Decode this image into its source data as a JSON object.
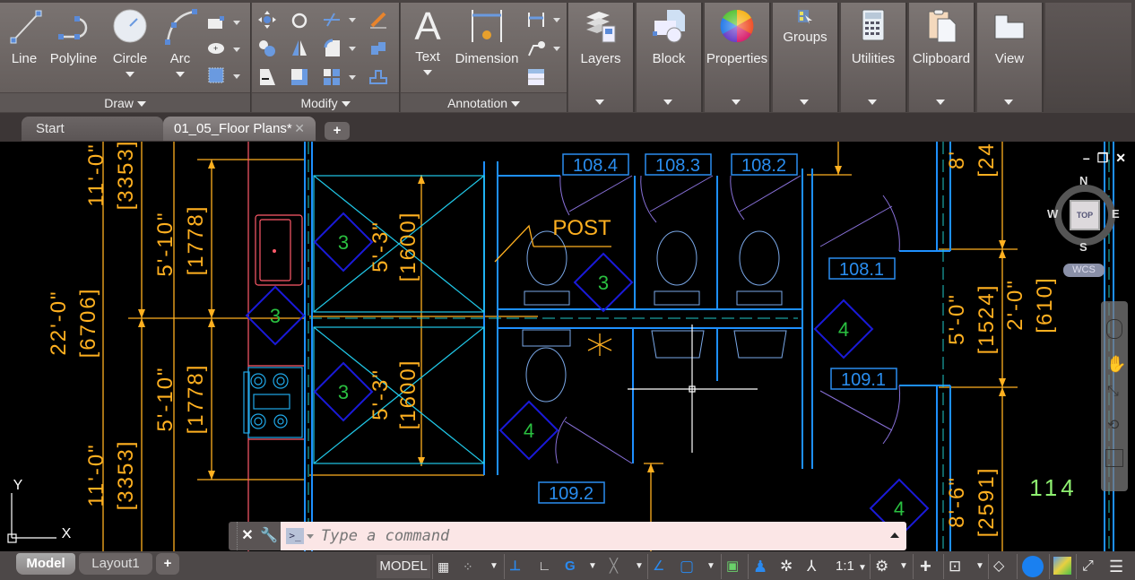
{
  "ribbon": {
    "draw": {
      "title": "Draw",
      "buttons": [
        {
          "label": "Line"
        },
        {
          "label": "Polyline"
        },
        {
          "label": "Circle"
        },
        {
          "label": "Arc"
        }
      ]
    },
    "modify": {
      "title": "Modify"
    },
    "annotation": {
      "title": "Annotation",
      "buttons": [
        {
          "label": "Text"
        },
        {
          "label": "Dimension"
        }
      ]
    },
    "panels": [
      {
        "label": "Layers",
        "icon": "layers-icon"
      },
      {
        "label": "Block",
        "icon": "block-icon"
      },
      {
        "label": "Properties",
        "icon": "properties-icon"
      },
      {
        "label": "Groups",
        "icon": "groups-icon"
      },
      {
        "label": "Utilities",
        "icon": "calculator-icon"
      },
      {
        "label": "Clipboard",
        "icon": "clipboard-icon"
      },
      {
        "label": "View",
        "icon": "view-icon"
      }
    ]
  },
  "doc_tabs": [
    {
      "label": "Start",
      "active": false
    },
    {
      "label": "01_05_Floor Plans*",
      "active": true
    }
  ],
  "drawing": {
    "room_tags": [
      "108.4",
      "108.3",
      "108.2",
      "108.1",
      "109.1",
      "109.2"
    ],
    "room_number": "114",
    "note": "POST",
    "type_markers": [
      "3",
      "3",
      "3",
      "3",
      "4",
      "4",
      "4"
    ],
    "dimensions_left": [
      "11'-0\"",
      "[3353]",
      "22'-0\"",
      "[6706]",
      "5'-10\"",
      "[1778]",
      "5'-10\"",
      "[1778]",
      "11'-0\"",
      "[3353]"
    ],
    "dimensions_mid": [
      "5'-3\"",
      "[1600]",
      "5'-3\"",
      "[1600]"
    ],
    "dimensions_right": [
      "8'",
      "[24",
      "5'-0\"",
      "[1524]",
      "2'-0\"",
      "[610]",
      "8'-6\"",
      "[2591]"
    ],
    "ucs": {
      "x": "X",
      "y": "Y"
    }
  },
  "viewcube": {
    "n": "N",
    "s": "S",
    "e": "E",
    "w": "W",
    "face": "TOP",
    "wcs": "WCS"
  },
  "window_controls": {
    "minimize": "–",
    "restore": "❐",
    "close": "✕"
  },
  "command": {
    "placeholder": "Type a command"
  },
  "layout_tabs": [
    {
      "label": "Model",
      "active": true
    },
    {
      "label": "Layout1",
      "active": false
    }
  ],
  "status": {
    "model": "MODEL",
    "scale": "1:1"
  }
}
